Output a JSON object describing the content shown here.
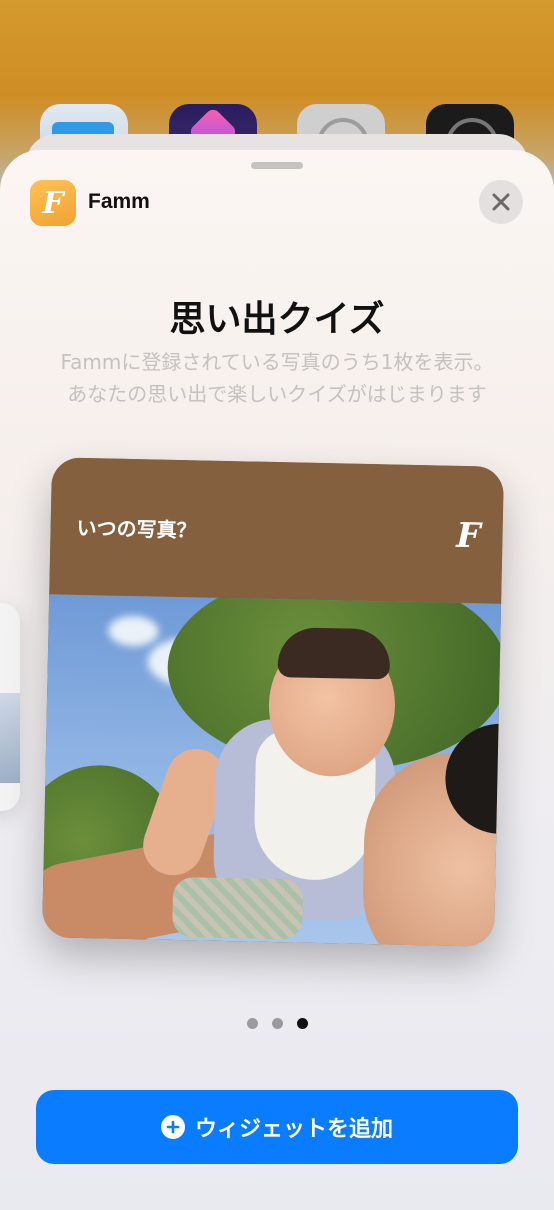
{
  "app": {
    "name": "Famm",
    "icon_letter": "F"
  },
  "header": {
    "close_icon": "close-icon"
  },
  "widget_info": {
    "title": "思い出クイズ",
    "description_line1": "Fammに登録されている写真のうち1枚を表示。",
    "description_line2": "あなたの思い出で楽しいクイズがはじまります"
  },
  "widget": {
    "question": "いつの写真？",
    "logo_letter": "F",
    "header_color": "#84603f"
  },
  "pagination": {
    "count": 3,
    "active_index": 2
  },
  "add_button": {
    "label": "ウィジェットを追加",
    "icon": "plus-circle-icon",
    "color": "#0a7cff"
  }
}
